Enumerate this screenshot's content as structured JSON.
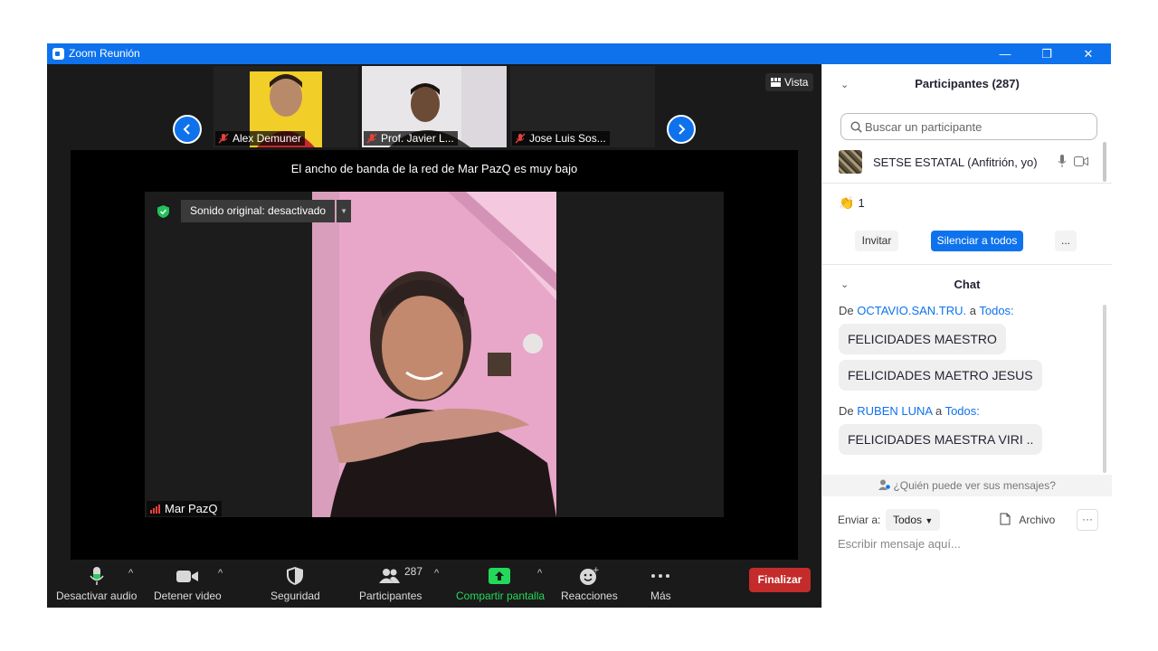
{
  "window": {
    "title": "Zoom Reunión",
    "minimize": "—",
    "restore": "❐",
    "close": "✕"
  },
  "strip": {
    "thumbnails": [
      {
        "name": "Alex Demuner"
      },
      {
        "name": "Prof. Javier L..."
      },
      {
        "name": "Jose Luis Sos..."
      }
    ],
    "view_label": "Vista"
  },
  "main": {
    "bandwidth_notice": "El ancho de banda de la red de Mar PazQ es muy bajo",
    "original_sound": "Sonido original: desactivado",
    "speaker_name": "Mar PazQ"
  },
  "toolbar": {
    "audio_label": "Desactivar audio",
    "video_label": "Detener video",
    "security_label": "Seguridad",
    "participants_label": "Participantes",
    "participants_count": "287",
    "share_label": "Compartir pantalla",
    "reactions_label": "Reacciones",
    "more_label": "Más",
    "end_label": "Finalizar",
    "share_color": "#23d959",
    "end_color": "#c42b2b"
  },
  "participants": {
    "header": "Participantes (287)",
    "search_placeholder": "Buscar un participante",
    "host_name": "SETSE ESTATAL (Anfitrión, yo)",
    "reaction_count": "1",
    "invite_label": "Invitar",
    "mute_all_label": "Silenciar a todos",
    "more_label": "...",
    "accent": "#0e72ed"
  },
  "chat": {
    "header": "Chat",
    "groups": [
      {
        "from_prefix": "De",
        "sender": "OCTAVIO.SAN.TRU.",
        "to_word": "a",
        "recipient": "Todos:",
        "messages": [
          "FELICIDADES MAESTRO",
          "FELICIDADES MAETRO JESUS"
        ]
      },
      {
        "from_prefix": "De",
        "sender": "RUBEN LUNA",
        "to_word": "a",
        "recipient": "Todos:",
        "messages": [
          "FELICIDADES MAESTRA VIRI .."
        ]
      }
    ],
    "who_can_see": "¿Quién puede ver sus mensajes?",
    "send_to_label": "Enviar a:",
    "send_to_value": "Todos",
    "file_label": "Archivo",
    "more_label": "···",
    "compose_placeholder": "Escribir mensaje aquí..."
  }
}
